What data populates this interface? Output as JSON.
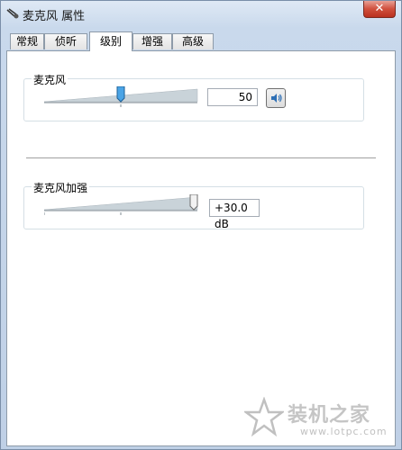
{
  "window": {
    "title": "麦克风 属性",
    "close_label": "✕"
  },
  "tabs": [
    {
      "label": "常规",
      "active": false
    },
    {
      "label": "侦听",
      "active": false
    },
    {
      "label": "级别",
      "active": true
    },
    {
      "label": "增强",
      "active": false
    },
    {
      "label": "高级",
      "active": false
    }
  ],
  "microphone": {
    "label": "麦克风",
    "value": "50",
    "level": 50,
    "icon": "speaker-icon"
  },
  "boost": {
    "label": "麦克风加强",
    "value": "+30.0 dB",
    "level": 100
  },
  "watermark": {
    "text": "装机之家",
    "url": "www.lotpc.com"
  },
  "colors": {
    "accent": "#3a8dd6",
    "close": "#c8402c",
    "slider_track": "#c9d3d9"
  }
}
